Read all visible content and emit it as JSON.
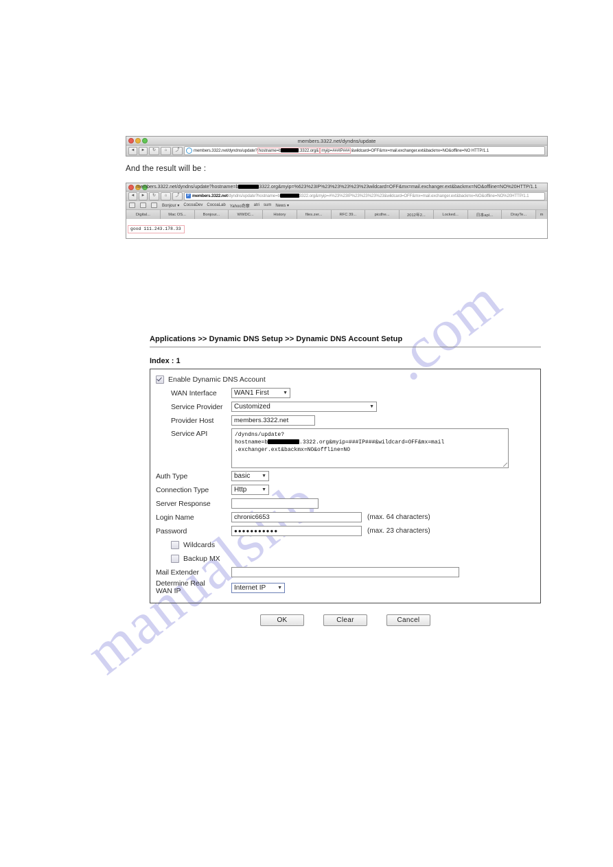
{
  "watermark": {
    "line1": ".com",
    "line2": "manualslib"
  },
  "browser1": {
    "title": "members.3322.net/dyndns/update",
    "nav": {
      "back": "◄",
      "forward": "►",
      "reload": "↻",
      "home": "⌂",
      "share": "⤴"
    },
    "url_part1": "members.3322.net/dyndns/update?",
    "url_highlight1_pre": "hostname=b",
    "url_highlight1_post": ".3322.org&",
    "url_highlight2": "myip=###IP###",
    "url_part2": "&wildcard=OFF&mx=mail.exchanger.ext&backmx=NO&offline=NO HTTP/1.1"
  },
  "caption": "And the result will be :",
  "browser2": {
    "title_pre": "members.3322.net/dyndns/update?hostname=b",
    "title_post": "3322.org&myip=%623%23IP%23%23%23%23%23wildcard=OFF&mx=mail.exchanger.ext&backmx=NO&offline=NO%20HTTP/1.1",
    "url_strong": "members.3322.net",
    "url_dim_pre": "/dyndns/update?hostname=b",
    "url_dim_post": "3322.org&myip=#%23%23IP%23%23%23%23&wildcard=OFF&mx=mail.exchanger.ext&backmx=NO&offline=NO%20HTTP/1.1",
    "bookmarks": [
      "Bonjour ▾",
      "CocoaDev",
      "CocoaLab",
      "Yahoo奇摩",
      "atri",
      "sum",
      "News ▾"
    ],
    "tabs": [
      "Digital...",
      "Mac OS...",
      "Bonjour...",
      "WWDC...",
      "History",
      "files.zer...",
      "RFC 39...",
      "picdhe...",
      "2012年2...",
      "Locked...",
      "日本apí...",
      "DrayTe..."
    ],
    "tab_overflow": "m",
    "result": "good 111.243.178.33"
  },
  "router": {
    "breadcrumb": "Applications >> Dynamic DNS Setup >> Dynamic DNS Account Setup",
    "index_label": "Index : 1",
    "enable_checkbox_label": "Enable Dynamic DNS Account",
    "enable_checked": true,
    "fields": {
      "wan_interface": {
        "label": "WAN Interface",
        "value": "WAN1 First"
      },
      "service_provider": {
        "label": "Service Provider",
        "value": "Customized"
      },
      "provider_host": {
        "label": "Provider Host",
        "value": "members.3322.net"
      },
      "service_api": {
        "label": "Service API",
        "line1": "/dyndns/update?",
        "line2_pre": "hostname=b",
        "line2_post": ".3322.org&myip=###IP###&wildcard=OFF&mx=mail",
        "line3": ".exchanger.ext&backmx=NO&offline=NO"
      },
      "auth_type": {
        "label": "Auth Type",
        "value": "basic"
      },
      "connection_type": {
        "label": "Connection Type",
        "value": "Http"
      },
      "server_response": {
        "label": "Server Response",
        "value": ""
      },
      "login_name": {
        "label": "Login Name",
        "value": "chronic6653",
        "hint": "(max. 64 characters)"
      },
      "password": {
        "label": "Password",
        "value": "●●●●●●●●●●●",
        "hint": "(max. 23 characters)"
      },
      "wildcards": {
        "label": "Wildcards",
        "checked": false
      },
      "backup_mx": {
        "label": "Backup MX",
        "checked": false
      },
      "mail_extender": {
        "label": "Mail Extender",
        "value": ""
      },
      "determine_real_wan_ip": {
        "label_line1": "Determine Real",
        "label_line2": "WAN IP",
        "value": "Internet IP"
      }
    },
    "buttons": {
      "ok": "OK",
      "clear": "Clear",
      "cancel": "Cancel"
    }
  }
}
